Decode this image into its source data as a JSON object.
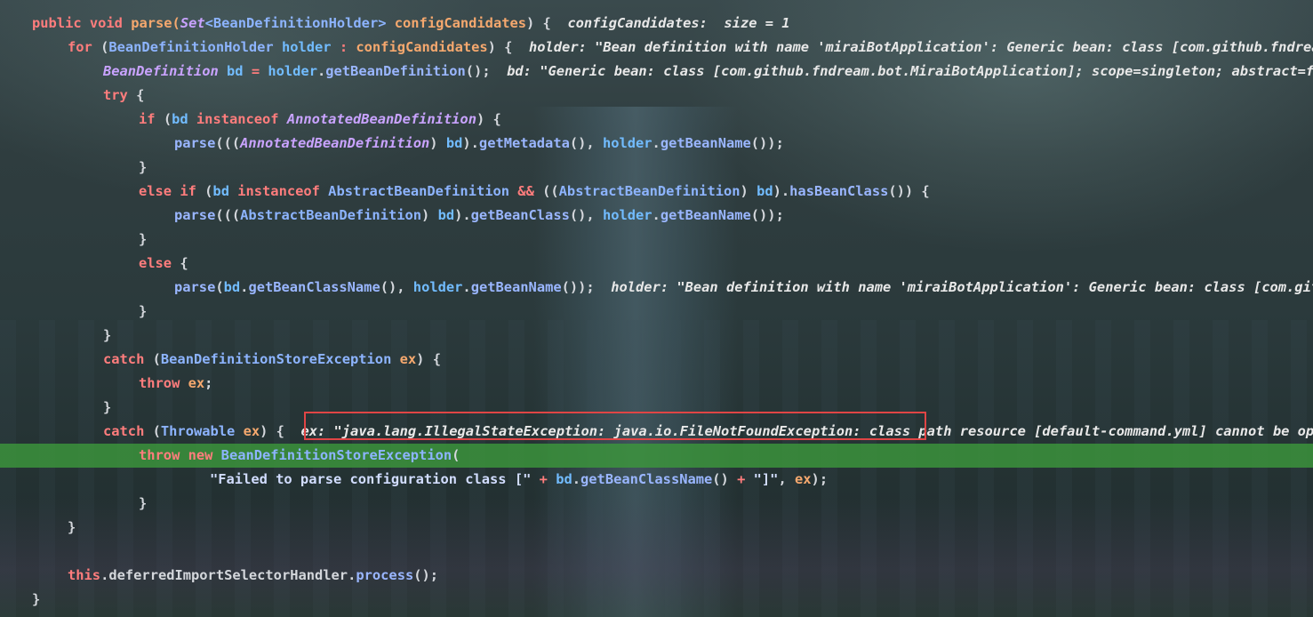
{
  "editor": {
    "language": "java",
    "execution_line_index": 18,
    "execution_line_color": "#3c963c",
    "highlight_box_color": "#e04545",
    "lines": [
      {
        "indent": 0,
        "tokens": [
          {
            "t": "public void ",
            "c": "kw"
          },
          {
            "t": "parse(",
            "c": "par"
          },
          {
            "t": "Set",
            "c": "ty"
          },
          {
            "t": "<BeanDefinitionHolder> ",
            "c": "cls"
          },
          {
            "t": "configCandidates",
            "c": "par"
          },
          {
            "t": ") {  ",
            "c": "pl"
          },
          {
            "t": "configCandidates:  size = 1",
            "c": "hint"
          }
        ]
      },
      {
        "indent": 1,
        "tokens": [
          {
            "t": "for ",
            "c": "kw"
          },
          {
            "t": "(",
            "c": "pl"
          },
          {
            "t": "BeanDefinitionHolder ",
            "c": "cls"
          },
          {
            "t": "holder ",
            "c": "var"
          },
          {
            "t": ": ",
            "c": "op"
          },
          {
            "t": "configCandidates",
            "c": "par"
          },
          {
            "t": ") {  ",
            "c": "pl"
          },
          {
            "t": "holder: \"Bean definition with name 'miraiBotApplication': Generic bean: class [com.github.fndream.bot.MiraiBotApplication]",
            "c": "hint"
          }
        ]
      },
      {
        "indent": 2,
        "tokens": [
          {
            "t": "BeanDefinition ",
            "c": "ty"
          },
          {
            "t": "bd ",
            "c": "var"
          },
          {
            "t": "= ",
            "c": "op"
          },
          {
            "t": "holder",
            "c": "var"
          },
          {
            "t": ".",
            "c": "pl"
          },
          {
            "t": "getBeanDefinition",
            "c": "mth"
          },
          {
            "t": "();  ",
            "c": "pl"
          },
          {
            "t": "bd: \"Generic bean: class [com.github.fndream.bot.MiraiBotApplication]; scope=singleton; abstract=false\"",
            "c": "hint"
          }
        ]
      },
      {
        "indent": 2,
        "tokens": [
          {
            "t": "try ",
            "c": "kw"
          },
          {
            "t": "{",
            "c": "pl"
          }
        ]
      },
      {
        "indent": 3,
        "tokens": [
          {
            "t": "if ",
            "c": "kw"
          },
          {
            "t": "(",
            "c": "pl"
          },
          {
            "t": "bd ",
            "c": "var"
          },
          {
            "t": "instanceof ",
            "c": "kw"
          },
          {
            "t": "AnnotatedBeanDefinition",
            "c": "ty"
          },
          {
            "t": ") {",
            "c": "pl"
          }
        ]
      },
      {
        "indent": 4,
        "tokens": [
          {
            "t": "parse",
            "c": "mth"
          },
          {
            "t": "(((",
            "c": "pl"
          },
          {
            "t": "AnnotatedBeanDefinition",
            "c": "ty"
          },
          {
            "t": ") ",
            "c": "pl"
          },
          {
            "t": "bd",
            "c": "var"
          },
          {
            "t": ").",
            "c": "pl"
          },
          {
            "t": "getMetadata",
            "c": "mth"
          },
          {
            "t": "(), ",
            "c": "pl"
          },
          {
            "t": "holder",
            "c": "var"
          },
          {
            "t": ".",
            "c": "pl"
          },
          {
            "t": "getBeanName",
            "c": "mth"
          },
          {
            "t": "());",
            "c": "pl"
          }
        ]
      },
      {
        "indent": 3,
        "tokens": [
          {
            "t": "}",
            "c": "pl"
          }
        ]
      },
      {
        "indent": 3,
        "tokens": [
          {
            "t": "else if ",
            "c": "kw"
          },
          {
            "t": "(",
            "c": "pl"
          },
          {
            "t": "bd ",
            "c": "var"
          },
          {
            "t": "instanceof ",
            "c": "kw"
          },
          {
            "t": "AbstractBeanDefinition ",
            "c": "cls"
          },
          {
            "t": "&& ",
            "c": "op"
          },
          {
            "t": "((",
            "c": "pl"
          },
          {
            "t": "AbstractBeanDefinition",
            "c": "cls"
          },
          {
            "t": ") ",
            "c": "pl"
          },
          {
            "t": "bd",
            "c": "var"
          },
          {
            "t": ").",
            "c": "pl"
          },
          {
            "t": "hasBeanClass",
            "c": "mth"
          },
          {
            "t": "()) {",
            "c": "pl"
          }
        ]
      },
      {
        "indent": 4,
        "tokens": [
          {
            "t": "parse",
            "c": "mth"
          },
          {
            "t": "(((",
            "c": "pl"
          },
          {
            "t": "AbstractBeanDefinition",
            "c": "cls"
          },
          {
            "t": ") ",
            "c": "pl"
          },
          {
            "t": "bd",
            "c": "var"
          },
          {
            "t": ").",
            "c": "pl"
          },
          {
            "t": "getBeanClass",
            "c": "mth"
          },
          {
            "t": "(), ",
            "c": "pl"
          },
          {
            "t": "holder",
            "c": "var"
          },
          {
            "t": ".",
            "c": "pl"
          },
          {
            "t": "getBeanName",
            "c": "mth"
          },
          {
            "t": "());",
            "c": "pl"
          }
        ]
      },
      {
        "indent": 3,
        "tokens": [
          {
            "t": "}",
            "c": "pl"
          }
        ]
      },
      {
        "indent": 3,
        "tokens": [
          {
            "t": "else ",
            "c": "kw"
          },
          {
            "t": "{",
            "c": "pl"
          }
        ]
      },
      {
        "indent": 4,
        "tokens": [
          {
            "t": "parse",
            "c": "mth"
          },
          {
            "t": "(",
            "c": "pl"
          },
          {
            "t": "bd",
            "c": "var"
          },
          {
            "t": ".",
            "c": "pl"
          },
          {
            "t": "getBeanClassName",
            "c": "mth"
          },
          {
            "t": "(), ",
            "c": "pl"
          },
          {
            "t": "holder",
            "c": "var"
          },
          {
            "t": ".",
            "c": "pl"
          },
          {
            "t": "getBeanName",
            "c": "mth"
          },
          {
            "t": "());  ",
            "c": "pl"
          },
          {
            "t": "holder: \"Bean definition with name 'miraiBotApplication': Generic bean: class [com.github.fndream.bot.MiraiBotApplication]",
            "c": "hint"
          }
        ]
      },
      {
        "indent": 3,
        "tokens": [
          {
            "t": "}",
            "c": "pl"
          }
        ]
      },
      {
        "indent": 2,
        "tokens": [
          {
            "t": "}",
            "c": "pl"
          }
        ]
      },
      {
        "indent": 2,
        "tokens": [
          {
            "t": "catch ",
            "c": "kw"
          },
          {
            "t": "(",
            "c": "pl"
          },
          {
            "t": "BeanDefinitionStoreException ",
            "c": "cls"
          },
          {
            "t": "ex",
            "c": "par"
          },
          {
            "t": ") {",
            "c": "pl"
          }
        ]
      },
      {
        "indent": 3,
        "tokens": [
          {
            "t": "throw ",
            "c": "kw"
          },
          {
            "t": "ex",
            "c": "par"
          },
          {
            "t": ";",
            "c": "pl"
          }
        ]
      },
      {
        "indent": 2,
        "tokens": [
          {
            "t": "}",
            "c": "pl"
          }
        ]
      },
      {
        "indent": 2,
        "tokens": [
          {
            "t": "catch ",
            "c": "kw"
          },
          {
            "t": "(",
            "c": "pl"
          },
          {
            "t": "Throwable ",
            "c": "cls"
          },
          {
            "t": "ex",
            "c": "par"
          },
          {
            "t": ") {  ",
            "c": "pl"
          },
          {
            "t": "ex: \"java.lang.IllegalStateException: java.io.FileNotFoundException: class path resource [default-command.yml] cannot be opened because it does not exist\"",
            "c": "hint"
          }
        ]
      },
      {
        "indent": 3,
        "tokens": [
          {
            "t": "throw new ",
            "c": "kw"
          },
          {
            "t": "BeanDefinitionStoreException",
            "c": "cls"
          },
          {
            "t": "(",
            "c": "pl"
          }
        ]
      },
      {
        "indent": 5,
        "tokens": [
          {
            "t": "\"Failed to parse configuration class [\" ",
            "c": "str"
          },
          {
            "t": "+ ",
            "c": "op"
          },
          {
            "t": "bd",
            "c": "var"
          },
          {
            "t": ".",
            "c": "pl"
          },
          {
            "t": "getBeanClassName",
            "c": "mth"
          },
          {
            "t": "() ",
            "c": "pl"
          },
          {
            "t": "+ ",
            "c": "op"
          },
          {
            "t": "\"]\"",
            "c": "str"
          },
          {
            "t": ", ",
            "c": "pl"
          },
          {
            "t": "ex",
            "c": "par"
          },
          {
            "t": ");",
            "c": "pl"
          }
        ]
      },
      {
        "indent": 3,
        "tokens": [
          {
            "t": "}",
            "c": "pl"
          }
        ]
      },
      {
        "indent": 1,
        "tokens": [
          {
            "t": "}",
            "c": "pl"
          }
        ]
      },
      {
        "indent": 0,
        "tokens": []
      },
      {
        "indent": 1,
        "tokens": [
          {
            "t": "this",
            "c": "kw"
          },
          {
            "t": ".",
            "c": "pl"
          },
          {
            "t": "deferredImportSelectorHandler",
            "c": "pl"
          },
          {
            "t": ".",
            "c": "pl"
          },
          {
            "t": "process",
            "c": "mth"
          },
          {
            "t": "();",
            "c": "pl"
          }
        ]
      },
      {
        "indent": 0,
        "tokens": [
          {
            "t": "}",
            "c": "pl"
          }
        ]
      }
    ]
  }
}
